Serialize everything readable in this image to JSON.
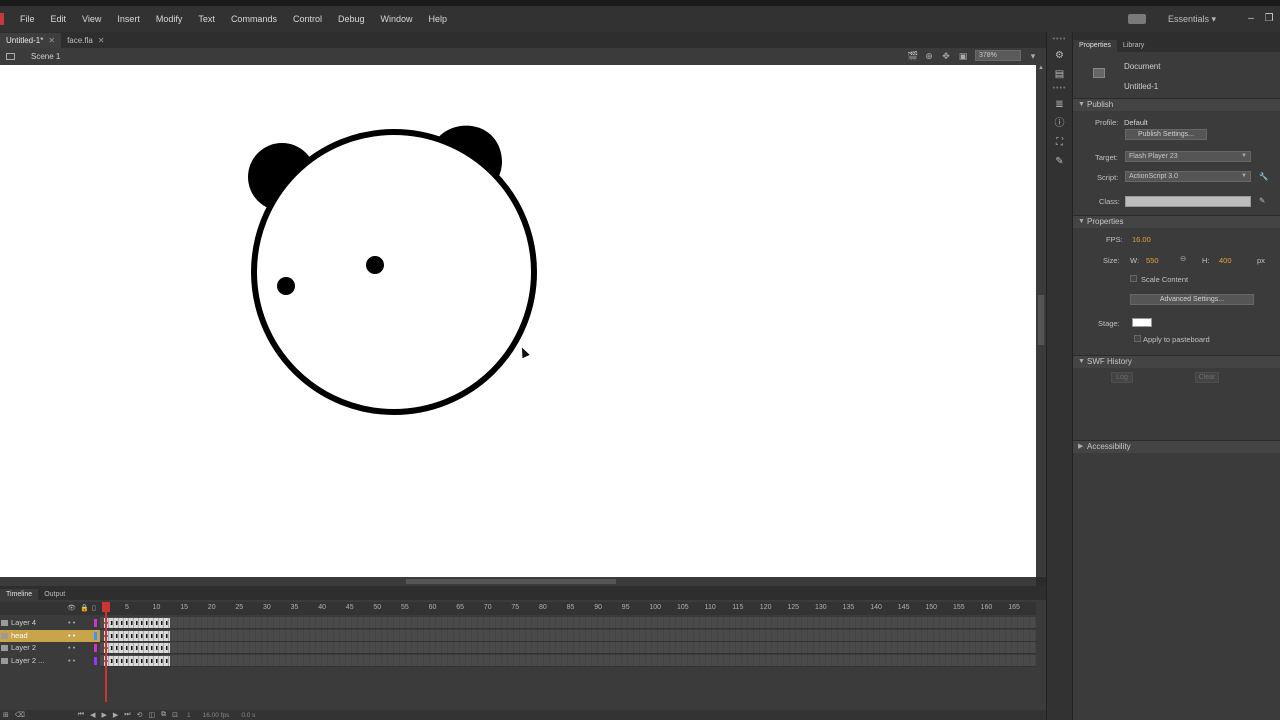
{
  "menu": [
    "File",
    "Edit",
    "View",
    "Insert",
    "Modify",
    "Text",
    "Commands",
    "Control",
    "Debug",
    "Window",
    "Help"
  ],
  "workspace": "Essentials",
  "doc_tabs": [
    {
      "label": "Untitled-1*",
      "active": true
    },
    {
      "label": "face.fla",
      "active": false
    }
  ],
  "edit_bar": {
    "scene": "Scene 1",
    "zoom": "378%"
  },
  "properties": {
    "tabs": [
      "Properties",
      "Library"
    ],
    "doc_type": "Document",
    "doc_name": "Untitled-1",
    "publish_section": "Publish",
    "profile_label": "Profile:",
    "profile_value": "Default",
    "publish_settings_btn": "Publish Settings...",
    "target_label": "Target:",
    "target_value": "Flash Player 23",
    "script_label": "Script:",
    "script_value": "ActionScript 3.0",
    "class_label": "Class:",
    "class_value": "",
    "properties_section": "Properties",
    "fps_label": "FPS:",
    "fps_value": "16.00",
    "size_label": "Size:",
    "w_label": "W:",
    "w_value": "550",
    "h_label": "H:",
    "h_value": "400",
    "px_label": "px",
    "scale_content_label": "Scale Content",
    "advanced_settings_btn": "Advanced Settings...",
    "stage_label": "Stage:",
    "stage_color": "#ffffff",
    "apply_pasteboard_label": "Apply to pasteboard",
    "swf_history_section": "SWF History",
    "log_btn": "Log",
    "clear_btn": "Clear",
    "accessibility_section": "Accessibility"
  },
  "timeline": {
    "tabs": [
      "Timeline",
      "Output"
    ],
    "frame_numbers": [
      "1",
      "5",
      "10",
      "15",
      "20",
      "25",
      "30",
      "35",
      "40",
      "45",
      "50",
      "55",
      "60",
      "65",
      "70",
      "75",
      "80",
      "85",
      "90",
      "95",
      "100",
      "105",
      "110",
      "115",
      "120",
      "125",
      "130",
      "135",
      "140",
      "145",
      "150",
      "155",
      "160",
      "165"
    ],
    "layers": [
      {
        "name": "Layer 4",
        "active": false,
        "color": "#cc33cc"
      },
      {
        "name": "head",
        "active": true,
        "color": "#3399ff"
      },
      {
        "name": "Layer 2",
        "active": false,
        "color": "#cc33cc"
      },
      {
        "name": "Layer 2 ...",
        "active": false,
        "color": "#9933ff"
      }
    ],
    "current_frame": "1",
    "fps_status": "16.00 fps",
    "time_status": "0.0 s"
  },
  "colors": {
    "accent_playhead": "#cc3333",
    "active_layer": "#c9a44b",
    "orange_value": "#e0a040"
  }
}
